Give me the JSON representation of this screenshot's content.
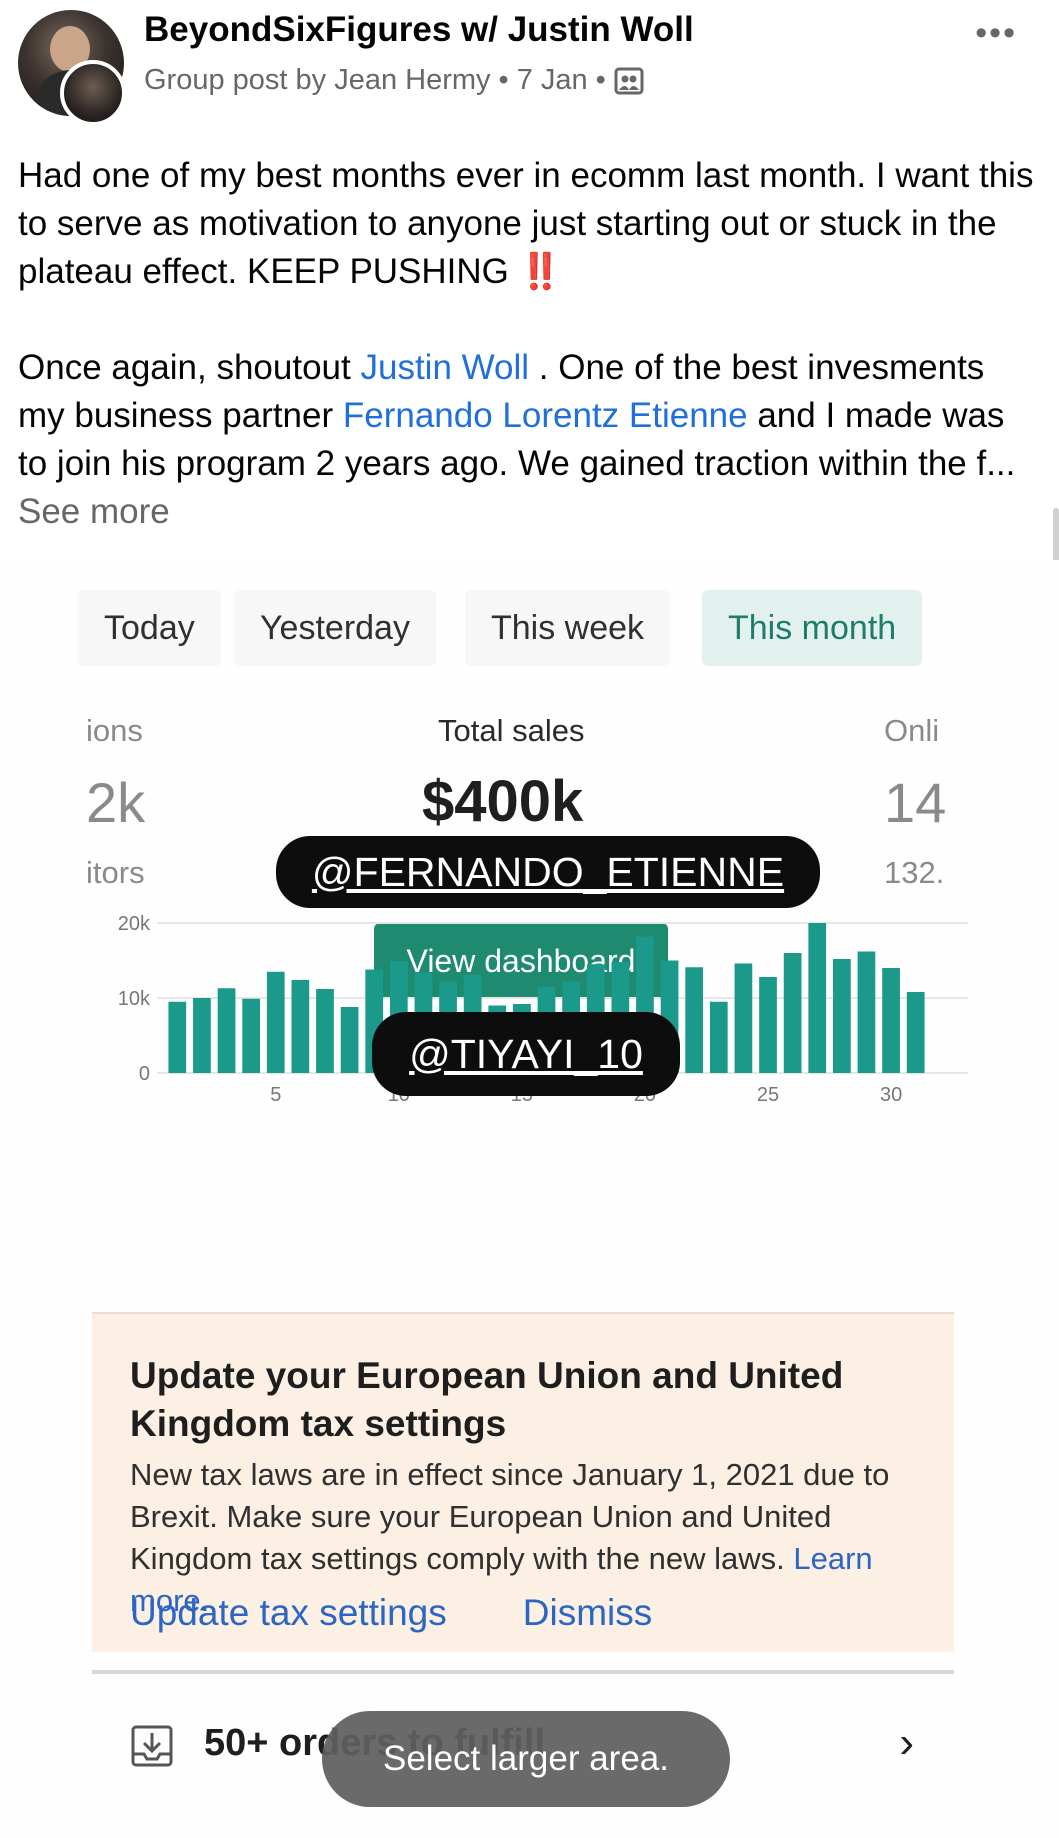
{
  "post": {
    "group_name": "BeyondSixFigures w/ Justin Woll",
    "meta_prefix": "Group post by Jean Hermy",
    "date": "7 Jan",
    "line1": "Had one of my best months ever in ecomm last month. I want this to serve as motivation to anyone just starting out or stuck in the plateau effect. KEEP PUSHING",
    "emoji": "‼️",
    "p2_part1": "Once again, shoutout",
    "mention1": "Justin Woll",
    "p2_part2": ". One of the best invesments my business partner",
    "mention2": "Fernando Lorentz Etienne",
    "p2_part3": "and I made was to join his program 2 years ago. We gained traction within the f...",
    "see_more": "See more"
  },
  "dashboard": {
    "tabs": [
      "Today",
      "Yesterday",
      "This week",
      "This month"
    ],
    "active_tab": "This month",
    "left_label": "ions",
    "left_value": "2k",
    "left_sub": "itors",
    "main_label": "Total sales",
    "main_value": "$400k",
    "right_label": "Onli",
    "right_value": "14",
    "right_sub": "132.",
    "view_dashboard": "View dashboard",
    "sticker1": "@FERNANDO_ETIENNE",
    "sticker2": "@TIYAYI_10"
  },
  "chart_data": {
    "type": "bar",
    "title": "",
    "xlabel": "",
    "ylabel": "",
    "ylim": [
      0,
      20000
    ],
    "y_ticks": [
      "0",
      "10k",
      "20k"
    ],
    "x_ticks": [
      "5",
      "10",
      "15",
      "20",
      "25",
      "30"
    ],
    "color": "#1b9a8c",
    "categories": [
      1,
      2,
      3,
      4,
      5,
      6,
      7,
      8,
      9,
      10,
      11,
      12,
      13,
      14,
      15,
      16,
      17,
      18,
      18.99,
      20,
      21,
      22,
      23,
      24,
      25,
      26,
      27,
      28,
      29,
      30,
      31
    ],
    "values": [
      9500,
      10000,
      11300,
      9900,
      13500,
      12400,
      11200,
      8800,
      13800,
      14900,
      13400,
      12200,
      13100,
      9000,
      9200,
      11500,
      12200,
      14500,
      14800,
      18200,
      15000,
      14100,
      9500,
      14600,
      12800,
      16000,
      20000,
      15200,
      16200,
      14000,
      10800
    ]
  },
  "tax": {
    "title": "Update your European Union and United Kingdom tax settings",
    "body": "New tax laws are in effect since January 1, 2021 due to Brexit. Make sure your European Union and United Kingdom tax settings comply with the new laws.",
    "learn_more": "Learn more.",
    "update_label": "Update tax settings",
    "dismiss_label": "Dismiss"
  },
  "orders": {
    "label": "50+ orders to fulfill"
  },
  "toast": "Select larger area."
}
